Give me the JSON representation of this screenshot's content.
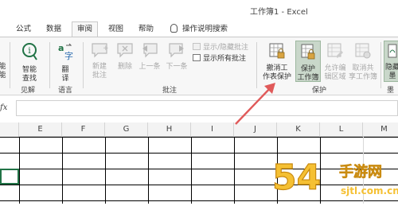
{
  "window": {
    "title": "工作簿1 - Excel"
  },
  "tabs": [
    {
      "label": "公式"
    },
    {
      "label": "数据"
    },
    {
      "label": "审阅"
    },
    {
      "label": "视图"
    },
    {
      "label": "帮助"
    }
  ],
  "search_tab": {
    "label": "操作说明搜索"
  },
  "ribbon": {
    "left_partial": {
      "line1": "能",
      "line2": "能"
    },
    "proofing": {
      "smart_lookup": {
        "line1": "智能",
        "line2": "查找"
      },
      "group_label": "见解"
    },
    "language": {
      "translate": {
        "line1": "翻",
        "line2": "译"
      },
      "group_label": "语言"
    },
    "comments": {
      "new_comment": {
        "line1": "新建",
        "line2": "批注"
      },
      "delete": {
        "label": "删除"
      },
      "previous": {
        "label": "上一条"
      },
      "next": {
        "label": "下一条"
      },
      "show_hide": {
        "label": "显示/隐藏批注"
      },
      "show_all": {
        "label": "显示所有批注"
      },
      "group_label": "批注"
    },
    "protect": {
      "unprotect_sheet": {
        "line1": "撤消工",
        "line2": "作表保护"
      },
      "protect_workbook": {
        "line1": "保护",
        "line2": "工作簿"
      },
      "allow_edit_ranges": {
        "line1": "允许编",
        "line2": "辑区域"
      },
      "unshare_workbook": {
        "line1": "取消共",
        "line2": "享工作簿"
      },
      "group_label": "保护"
    },
    "ink": {
      "line1": "隐藏",
      "line2": "墨",
      "group_label": "墨"
    }
  },
  "formula_bar": {
    "fx_label": "fx",
    "value": ""
  },
  "columns": [
    "E",
    "F",
    "G",
    "H",
    "I",
    "J",
    "K",
    "L",
    "M"
  ],
  "watermark": {
    "text": "54 手游网",
    "domain": "sjtl.com.cn"
  },
  "colors": {
    "accent": "#217346",
    "arrow": "#e05a5a",
    "watermark": "#f5c033"
  }
}
